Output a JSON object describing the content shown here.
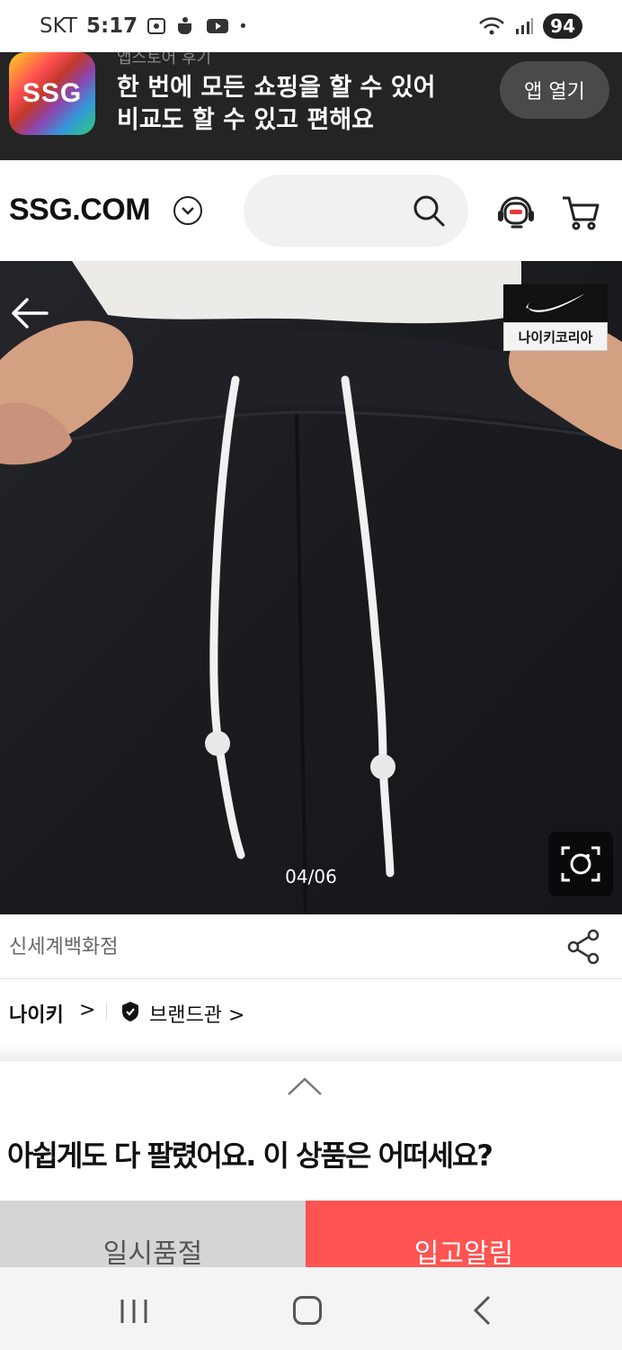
{
  "status_bar": {
    "carrier": "SKT",
    "time": "5:17",
    "battery": "94"
  },
  "app_banner": {
    "logo_text": "SSG",
    "subtitle": "앱스토어 후기",
    "line1": "한 번에 모든 쇼핑을 할 수 있어",
    "line2": "비교도 할 수 있고 편해요",
    "open_label": "앱 열기"
  },
  "header": {
    "brand": "SSG.COM"
  },
  "product": {
    "image_counter": "04/06",
    "badge_label": "나이키코리아",
    "seller": "신세계백화점",
    "brand": "나이키",
    "brand_arrow": ">",
    "brandhall": "브랜드관 >"
  },
  "soldout": {
    "message": "아쉽게도 다 팔렸어요. 이 상품은 어떠세요?",
    "soldout_button": "일시품절",
    "notify_button": "입고알림"
  },
  "colors": {
    "accent": "#ff5452",
    "banner_bg": "#242424",
    "soldout_bg": "#d5d5d5"
  }
}
